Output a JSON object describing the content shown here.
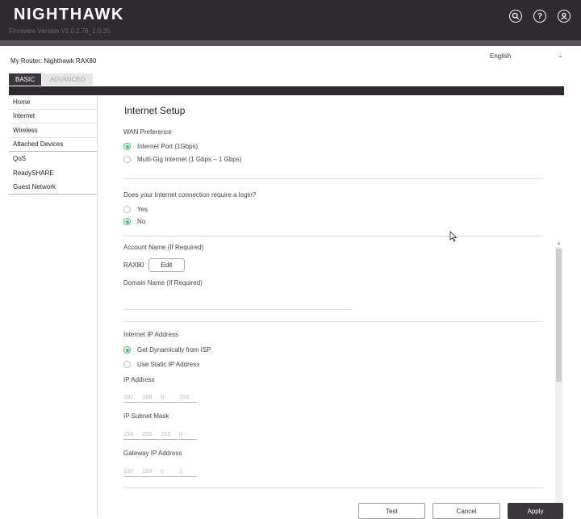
{
  "header": {
    "logo": "NIGHTHAWK",
    "firmware": "Firmware Version V1.0.2.76_1.0.35",
    "icons": [
      "search-icon",
      "help-icon",
      "user-icon"
    ]
  },
  "router": {
    "label": "My Router: Nighthawk RAX80"
  },
  "language": {
    "selected": "English"
  },
  "tabs": {
    "basic": "BASIC",
    "advanced": "ADVANCED"
  },
  "sidebar": {
    "items": [
      {
        "label": "Home"
      },
      {
        "label": "Internet"
      },
      {
        "label": "Wireless"
      },
      {
        "label": "Attached Devices"
      },
      {
        "label": "QoS"
      },
      {
        "label": "ReadySHARE"
      },
      {
        "label": "Guest Network"
      }
    ]
  },
  "main": {
    "title": "Internet Setup",
    "wan": {
      "label": "WAN Preference",
      "opt1": "Internet Port (1Gbps)",
      "opt2": "Multi-Gig Internet (1 Gbps – 1 Gbps)",
      "selected": "opt1"
    },
    "login": {
      "question": "Does your Internet connection require a login?",
      "yes": "Yes",
      "no": "No",
      "selected": "no"
    },
    "account": {
      "label": "Account Name  (If Required)",
      "value": "RAX80",
      "edit": "Edit"
    },
    "domain": {
      "label": "Domain Name  (If Required)"
    },
    "ip": {
      "label": "Internet IP Address",
      "dynamic": "Get Dynamically from ISP",
      "static": "Use Static IP Address",
      "selected": "dynamic",
      "ip_label": "IP Address",
      "ip_value": [
        "192",
        "168",
        "0",
        "103"
      ],
      "mask_label": "IP Subnet Mask",
      "mask_value": [
        "255",
        "255",
        "255",
        "0"
      ],
      "gw_label": "Gateway IP Address",
      "gw_value": [
        "192",
        "168",
        "0",
        "1"
      ]
    }
  },
  "buttons": {
    "test": "Test",
    "cancel": "Cancel",
    "apply": "Apply"
  },
  "colors": {
    "accent_green": "#2fc46b",
    "header_bg": "#2e2a30"
  }
}
